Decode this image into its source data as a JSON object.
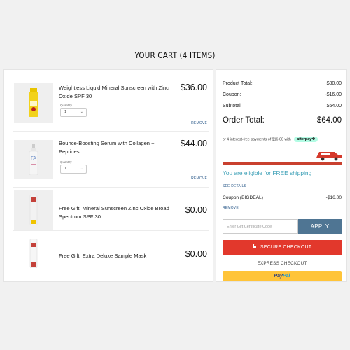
{
  "cart": {
    "title": "YOUR CART (4 ITEMS)",
    "items": [
      {
        "name": "Weightless Liquid Mineral Sunscreen with Zinc Oxide SPF 30",
        "price": "$36.00",
        "quantity_label": "Quantity",
        "quantity": "1",
        "remove_label": "REMOVE"
      },
      {
        "name": "Bounce-Boosting Serum with Collagen + Peptides",
        "price": "$44.00",
        "quantity_label": "Quantity",
        "quantity": "1",
        "remove_label": "REMOVE"
      },
      {
        "name": "Free Gift: Mineral Sunscreen Zinc Oxide Broad Spectrum SPF 30",
        "price": "$0.00"
      },
      {
        "name": "Free Gift: Extra Deluxe Sample Mask",
        "price": "$0.00"
      }
    ]
  },
  "summary": {
    "product_total_label": "Product Total:",
    "product_total": "$80.00",
    "coupon_label": "Coupon:",
    "coupon": "-$16.00",
    "subtotal_label": "Subtotal:",
    "subtotal": "$64.00",
    "order_total_label": "Order Total:",
    "order_total": "$64.00",
    "afterpay_text": "or 4 interest-free payments of $16.00 with",
    "afterpay_badge": "afterpay⟲",
    "free_shipping_text": "You are eligible for FREE shipping",
    "see_details": "SEE DETAILS",
    "applied_coupon_label": "Coupon (BIGDEAL)",
    "applied_coupon_value": "-$16.00",
    "coupon_remove": "REMOVE",
    "gift_placeholder": "Enter Gift Certificate Code",
    "apply_label": "APPLY",
    "secure_checkout": "SECURE CHECKOUT",
    "express_checkout": "EXPRESS CHECKOUT",
    "paypal_pay": "Pay",
    "paypal_pal": "Pal"
  },
  "colors": {
    "checkout_red": "#e2382c",
    "apply_blue": "#4f7593",
    "paypal_yellow": "#ffc439",
    "shipping_teal": "#3b9fb6",
    "afterpay_mint": "#b2fce4"
  },
  "icons": [
    "chevron-down-icon",
    "lock-icon",
    "truck-icon"
  ]
}
